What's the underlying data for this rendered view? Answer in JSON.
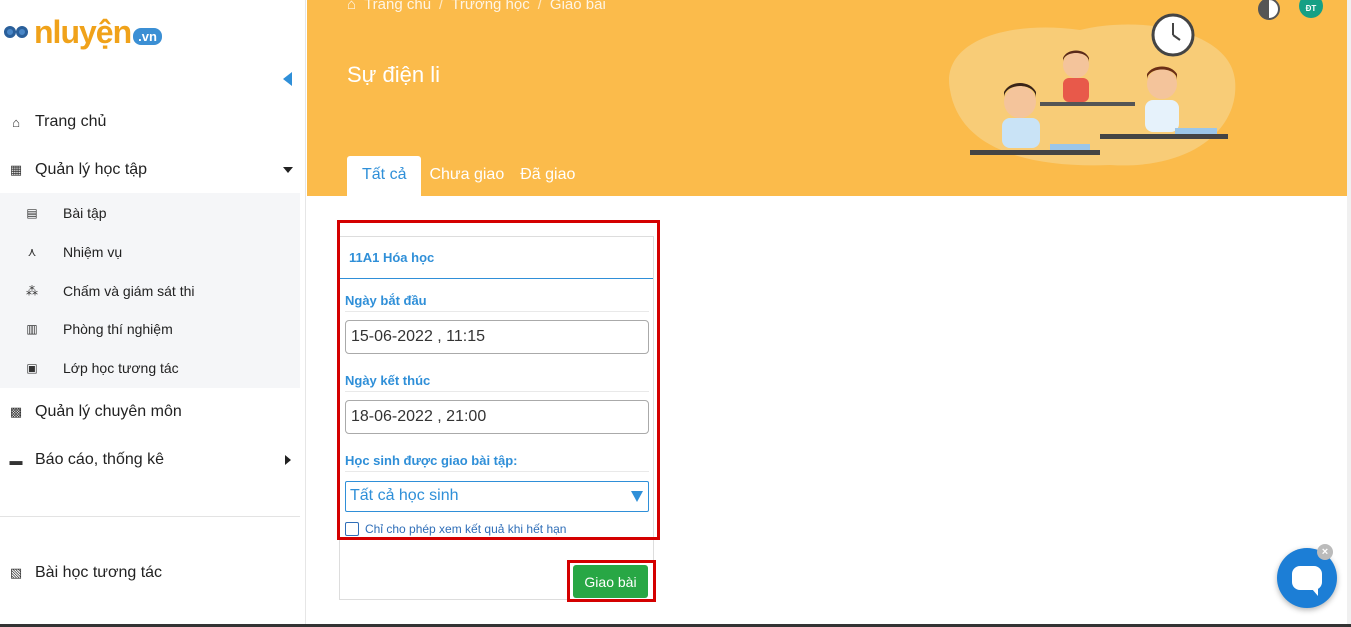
{
  "logo": {
    "text": "nluyện",
    "suffix": ".vn"
  },
  "sidebar": {
    "items": [
      {
        "label": "Trang chủ",
        "icon": "home-icon"
      },
      {
        "label": "Quản lý học tập",
        "icon": "school-icon"
      },
      {
        "label": "Quản lý chuyên môn",
        "icon": "calendar-icon"
      },
      {
        "label": "Báo cáo, thống kê",
        "icon": "report-icon"
      },
      {
        "label": "Bài học tương tác",
        "icon": "interactive-lesson-icon"
      }
    ],
    "subitems": [
      {
        "label": "Bài tập",
        "icon": "homework-icon"
      },
      {
        "label": "Nhiệm vụ",
        "icon": "compass-icon"
      },
      {
        "label": "Chấm và giám sát thi",
        "icon": "exam-monitor-icon"
      },
      {
        "label": "Phòng thí nghiệm",
        "icon": "lab-icon"
      },
      {
        "label": "Lớp học tương tác",
        "icon": "interactive-class-icon"
      }
    ]
  },
  "header": {
    "breadcrumb": [
      "Trang chủ",
      "Trường học",
      "Giao bài"
    ],
    "title": "Sự điện li",
    "tabs": [
      {
        "label": "Tất cả",
        "active": true
      },
      {
        "label": "Chưa giao",
        "active": false
      },
      {
        "label": "Đã giao",
        "active": false
      }
    ],
    "avatar_initials": "ĐT"
  },
  "form": {
    "class_name": "11A1 Hóa học",
    "start_label": "Ngày bắt đầu",
    "start_value": "15-06-2022 , 11:15",
    "end_label": "Ngày kết thúc",
    "end_value": "18-06-2022 , 21:00",
    "students_label": "Học sinh được giao bài tập:",
    "students_value": "Tất cả học sinh",
    "checkbox_label": "Chỉ cho phép xem kết quả khi hết hạn",
    "checkbox_checked": false,
    "submit_label": "Giao bài"
  },
  "colors": {
    "banner": "#fbbb4b",
    "accent": "#2f8fd8",
    "submit": "#28a745",
    "highlight": "#d40000"
  }
}
